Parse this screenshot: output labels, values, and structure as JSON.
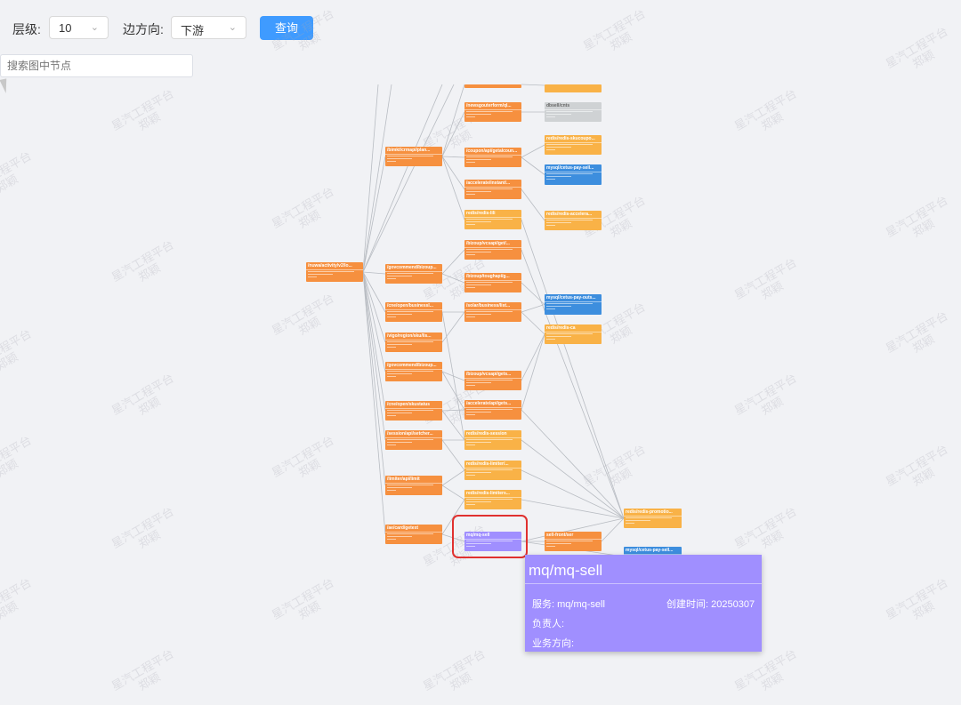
{
  "toolbar": {
    "level_label": "层级:",
    "level_value": "10",
    "direction_label": "边方向:",
    "direction_value": "下游",
    "query_button": "查询",
    "chevron_icon": "chevron-down-icon"
  },
  "search": {
    "placeholder": "搜索图中节点"
  },
  "watermark": {
    "line1": "星汽工程平台",
    "line2": "郑颖"
  },
  "colors": {
    "api": "#f6903f",
    "redis": "#f9b247",
    "mysql": "#3d8ede",
    "other": "#cfd2d4",
    "mq": "#a08fff",
    "highlight": "#e0312f",
    "button": "#3f9bff"
  },
  "graph": {
    "nodes": [
      {
        "id": "n1",
        "label": "/nuwa/activity/v2/lo...",
        "kind": "api"
      },
      {
        "id": "n2",
        "label": "/bimkt/crmapi/plan...",
        "kind": "api"
      },
      {
        "id": "n3",
        "label": "/govcommend/bizoup...",
        "kind": "api"
      },
      {
        "id": "n4",
        "label": "/cne/open/businessI...",
        "kind": "api"
      },
      {
        "id": "n5",
        "label": "/vigo/region/sku/lis...",
        "kind": "api"
      },
      {
        "id": "n6",
        "label": "/govcommend/bizoup...",
        "kind": "api"
      },
      {
        "id": "n7",
        "label": "/cne/open/skustatus",
        "kind": "api"
      },
      {
        "id": "n8",
        "label": "/session/api/setcher...",
        "kind": "api"
      },
      {
        "id": "n9",
        "label": "/limiter/api/limit",
        "kind": "api"
      },
      {
        "id": "n10",
        "label": "/ae/card/getext",
        "kind": "api"
      },
      {
        "id": "m0",
        "label": "",
        "kind": "api"
      },
      {
        "id": "m1",
        "label": "/newsgouterform/ql...",
        "kind": "api"
      },
      {
        "id": "m2",
        "label": "/coupon/api/getalcoun...",
        "kind": "api"
      },
      {
        "id": "m3",
        "label": "/accelerate/instant/...",
        "kind": "api"
      },
      {
        "id": "m4",
        "label": "redis/redis-lili",
        "kind": "redis"
      },
      {
        "id": "m5",
        "label": "/bizoup/vcsapi/get/...",
        "kind": "api"
      },
      {
        "id": "m6",
        "label": "/bizoup/toughapi/g...",
        "kind": "api"
      },
      {
        "id": "m7",
        "label": "/solar/business/list...",
        "kind": "api"
      },
      {
        "id": "m8",
        "label": "/bizoup/vcsapi/gets...",
        "kind": "api"
      },
      {
        "id": "m9",
        "label": "/accelerate/api/gets...",
        "kind": "api"
      },
      {
        "id": "m10",
        "label": "redis/redis-session",
        "kind": "redis"
      },
      {
        "id": "m11",
        "label": "redis/redis-limiter/...",
        "kind": "redis"
      },
      {
        "id": "m12",
        "label": "redis/redis-limiters...",
        "kind": "redis"
      },
      {
        "id": "m13",
        "label": "mq/mq-sell",
        "kind": "mq"
      },
      {
        "id": "r0",
        "label": "",
        "kind": "redis"
      },
      {
        "id": "r1",
        "label": "dbsell/cnts",
        "kind": "other"
      },
      {
        "id": "r2",
        "label": "redis/redis-skucoupo...",
        "kind": "redis"
      },
      {
        "id": "r3",
        "label": "mysql/cetus-pay-sell...",
        "kind": "mysql"
      },
      {
        "id": "r4",
        "label": "redis/redis-accelera...",
        "kind": "redis"
      },
      {
        "id": "r5",
        "label": "mysql/cetus-pay-outs...",
        "kind": "mysql"
      },
      {
        "id": "r6",
        "label": "redis/redis-ca",
        "kind": "redis"
      },
      {
        "id": "r7",
        "label": "sell-front/ser",
        "kind": "api"
      },
      {
        "id": "f1",
        "label": "redis/redis-promotio...",
        "kind": "redis"
      },
      {
        "id": "f2",
        "label": "mysql/cetus-pay-sell...",
        "kind": "mysql"
      }
    ],
    "edges": [
      [
        "n1",
        "n2"
      ],
      [
        "n1",
        "n3"
      ],
      [
        "n1",
        "n4"
      ],
      [
        "n1",
        "n5"
      ],
      [
        "n1",
        "n6"
      ],
      [
        "n1",
        "n7"
      ],
      [
        "n1",
        "n8"
      ],
      [
        "n1",
        "n9"
      ],
      [
        "n1",
        "n10"
      ],
      [
        "n2",
        "m1"
      ],
      [
        "n2",
        "m2"
      ],
      [
        "n2",
        "m3"
      ],
      [
        "n2",
        "m4"
      ],
      [
        "n2",
        "m0"
      ],
      [
        "n3",
        "m6"
      ],
      [
        "n3",
        "m5"
      ],
      [
        "n4",
        "m7"
      ],
      [
        "n4",
        "m10"
      ],
      [
        "n5",
        "m7"
      ],
      [
        "n6",
        "m8"
      ],
      [
        "n6",
        "m9"
      ],
      [
        "n7",
        "m10"
      ],
      [
        "n7",
        "m9"
      ],
      [
        "n8",
        "m10"
      ],
      [
        "n8",
        "m11"
      ],
      [
        "n9",
        "m11"
      ],
      [
        "n9",
        "m12"
      ],
      [
        "n10",
        "m13"
      ],
      [
        "n10",
        "m12"
      ],
      [
        "m0",
        "r0"
      ],
      [
        "m1",
        "r1"
      ],
      [
        "m2",
        "r2"
      ],
      [
        "m2",
        "r3"
      ],
      [
        "m3",
        "r4"
      ],
      [
        "m6",
        "r5"
      ],
      [
        "m7",
        "r5"
      ],
      [
        "m7",
        "r6"
      ],
      [
        "m8",
        "r6"
      ],
      [
        "m9",
        "r6"
      ],
      [
        "m10",
        "f1"
      ],
      [
        "m12",
        "f1"
      ],
      [
        "m13",
        "r7"
      ],
      [
        "m13",
        "f1"
      ],
      [
        "r7",
        "f1"
      ],
      [
        "m13",
        "f2"
      ],
      [
        "m5",
        "f1"
      ],
      [
        "m4",
        "f1"
      ],
      [
        "m11",
        "f1"
      ],
      [
        "m9",
        "f1"
      ]
    ]
  },
  "tooltip": {
    "title": "mq/mq-sell",
    "service_label": "服务:",
    "service_value": "mq/mq-sell",
    "created_label": "创建时间:",
    "created_value": "20250307",
    "owner_label": "负责人:",
    "owner_value": "",
    "direction_label": "业务方向:",
    "direction_value": ""
  }
}
